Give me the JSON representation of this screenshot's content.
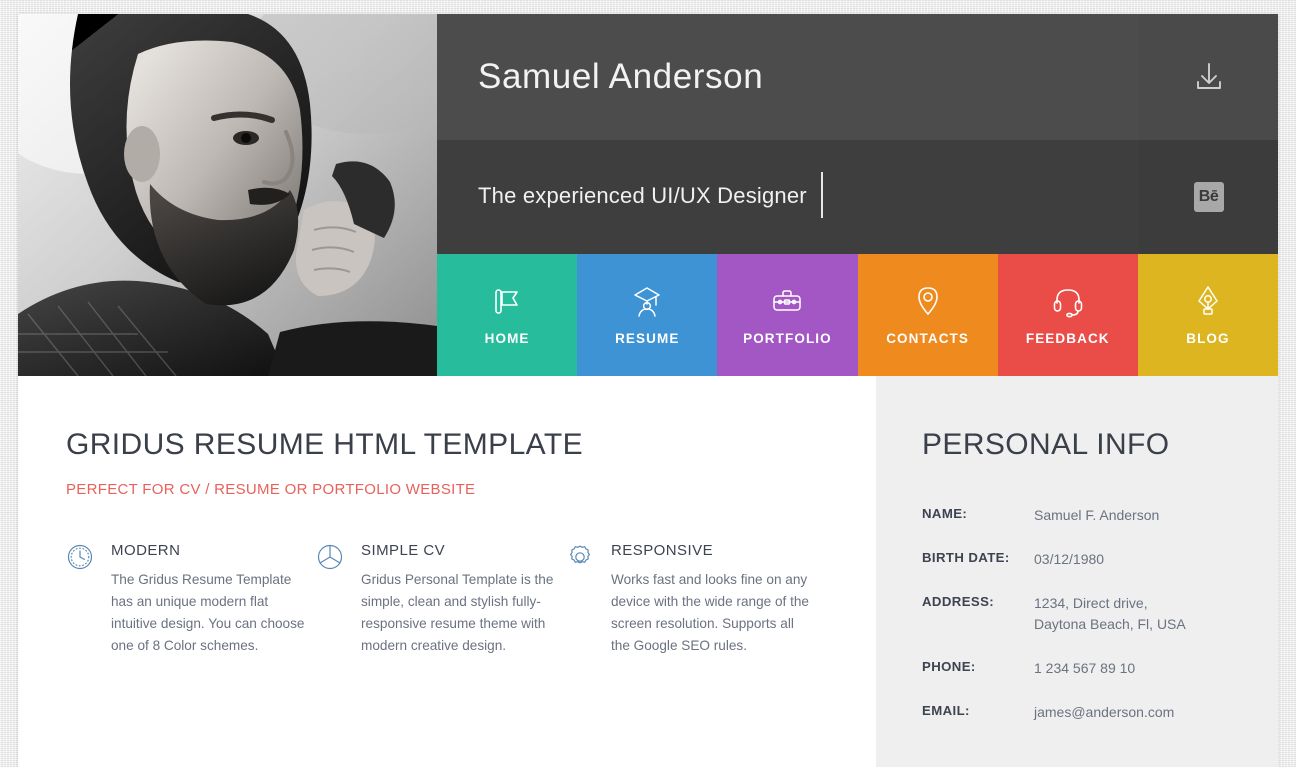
{
  "hero": {
    "name": "Samuel Anderson",
    "tagline": "The experienced UI/UX Designer",
    "download_icon": "download-icon",
    "behance_label": "Bē"
  },
  "nav": {
    "items": [
      {
        "label": "HOME",
        "icon": "flag-icon",
        "color": "#27bd9c"
      },
      {
        "label": "RESUME",
        "icon": "graduation-cap-icon",
        "color": "#3e93d4"
      },
      {
        "label": "PORTFOLIO",
        "icon": "briefcase-icon",
        "color": "#a257c4"
      },
      {
        "label": "CONTACTS",
        "icon": "map-pin-icon",
        "color": "#ef8a1f"
      },
      {
        "label": "FEEDBACK",
        "icon": "headset-icon",
        "color": "#ea4c48"
      },
      {
        "label": "BLOG",
        "icon": "pen-nib-icon",
        "color": "#ddb521"
      }
    ]
  },
  "main": {
    "title": "GRIDUS RESUME HTML TEMPLATE",
    "subtitle": "PERFECT FOR CV / RESUME OR PORTFOLIO WEBSITE",
    "subtitle_color": "#e8615a",
    "features": [
      {
        "icon": "clock-icon",
        "title": "MODERN",
        "text": "The Gridus Resume Template has an unique modern flat intuitive design. You can choose one of 8 Color schemes."
      },
      {
        "icon": "pie-chart-icon",
        "title": "SIMPLE CV",
        "text": "Gridus Personal Template is the simple, clean and stylish fully-responsive resume theme with modern creative design."
      },
      {
        "icon": "gear-icon",
        "title": "RESPONSIVE",
        "text": "Works fast and looks fine on any device with the wide range of the screen resolution. Supports all the Google SEO rules."
      }
    ]
  },
  "personal_info": {
    "title": "PERSONAL INFO",
    "rows": [
      {
        "label": "NAME:",
        "value": "Samuel F. Anderson",
        "value2": ""
      },
      {
        "label": "BIRTH DATE:",
        "value": "03/12/1980",
        "value2": ""
      },
      {
        "label": "ADDRESS:",
        "value": "1234, Direct drive,",
        "value2": "Daytona Beach, Fl, USA"
      },
      {
        "label": "PHONE:",
        "value": "1 234 567 89 10",
        "value2": ""
      },
      {
        "label": "EMAIL:",
        "value": "james@anderson.com",
        "value2": ""
      }
    ]
  }
}
